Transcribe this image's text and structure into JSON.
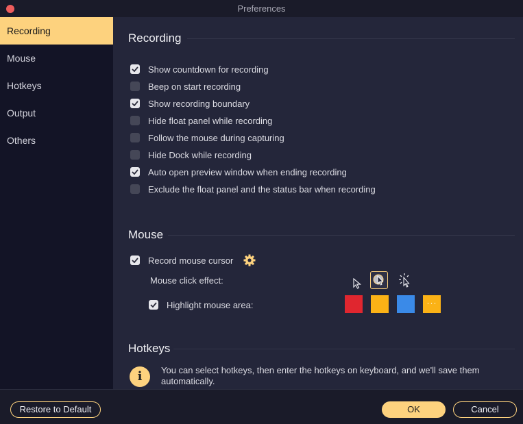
{
  "window": {
    "title": "Preferences"
  },
  "sidebar": {
    "items": [
      {
        "label": "Recording",
        "active": true
      },
      {
        "label": "Mouse",
        "active": false
      },
      {
        "label": "Hotkeys",
        "active": false
      },
      {
        "label": "Output",
        "active": false
      },
      {
        "label": "Others",
        "active": false
      }
    ]
  },
  "recording": {
    "title": "Recording",
    "options": [
      {
        "label": "Show countdown for recording",
        "checked": true
      },
      {
        "label": "Beep on start recording",
        "checked": false
      },
      {
        "label": "Show recording boundary",
        "checked": true
      },
      {
        "label": "Hide float panel while recording",
        "checked": false
      },
      {
        "label": "Follow the mouse during capturing",
        "checked": false
      },
      {
        "label": "Hide Dock while recording",
        "checked": false
      },
      {
        "label": "Auto open preview window when ending recording",
        "checked": true
      },
      {
        "label": "Exclude the float panel and the status bar when recording",
        "checked": false
      }
    ]
  },
  "mouse": {
    "title": "Mouse",
    "record_cursor": {
      "label": "Record mouse cursor",
      "checked": true
    },
    "click_effect_label": "Mouse click effect:",
    "click_effects": [
      "cursor-plain-icon",
      "cursor-circle-icon",
      "cursor-burst-icon"
    ],
    "selected_click_effect": 1,
    "highlight": {
      "label": "Highlight mouse area:",
      "checked": true
    },
    "highlight_colors": [
      "#e0262f",
      "#fbb216",
      "#3a8ae8"
    ],
    "more_colors_label": "···"
  },
  "hotkeys": {
    "title": "Hotkeys",
    "info": "You can select hotkeys, then enter the hotkeys on keyboard, and we'll save them automatically."
  },
  "footer": {
    "restore_label": "Restore to Default",
    "ok_label": "OK",
    "cancel_label": "Cancel"
  },
  "colors": {
    "accent": "#fdd27e",
    "sidebar_bg": "#131426",
    "content_bg": "#24263a",
    "close": "#ee5d5c"
  }
}
